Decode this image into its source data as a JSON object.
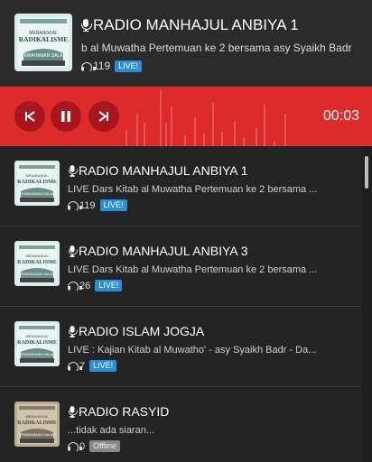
{
  "now_playing": {
    "title": "RADIO MANHAJUL ANBIYA 1",
    "subtitle": "b al Muwatha Pertemuan ke 2 bersama asy Syaikh Badr",
    "listeners": "119",
    "badge": "LIVE!",
    "thumb_text": [
      "MENANGKAL",
      "RADIKALISME",
      "PEMAHAMAN SALAF"
    ]
  },
  "player": {
    "prev_icon": "skip-previous-icon",
    "pause_icon": "pause-icon",
    "next_icon": "skip-next-icon",
    "time": "00:03",
    "accent_color": "#dd2a2a"
  },
  "stations": [
    {
      "title": "RADIO MANHAJUL ANBIYA 1",
      "subtitle": "LIVE Dars Kitab al Muwatha Pertemuan ke 2 bersama ...",
      "listeners": "119",
      "badge": "LIVE!",
      "status": "live"
    },
    {
      "title": "RADIO MANHAJUL ANBIYA 3",
      "subtitle": "LIVE Dars Kitab al Muwatha Pertemuan ke 2 bersama ...",
      "listeners": "26",
      "badge": "LIVE!",
      "status": "live"
    },
    {
      "title": "RADIO ISLAM JOGJA",
      "subtitle": "LIVE : Kajian Kitab al Muwatho' - asy Syaikh Badr - Da...",
      "listeners": "7",
      "badge": "LIVE!",
      "status": "live"
    },
    {
      "title": "RADIO RASYID",
      "subtitle": "...tidak ada siaran...",
      "listeners": "0",
      "badge": "Offline",
      "status": "offline"
    }
  ]
}
